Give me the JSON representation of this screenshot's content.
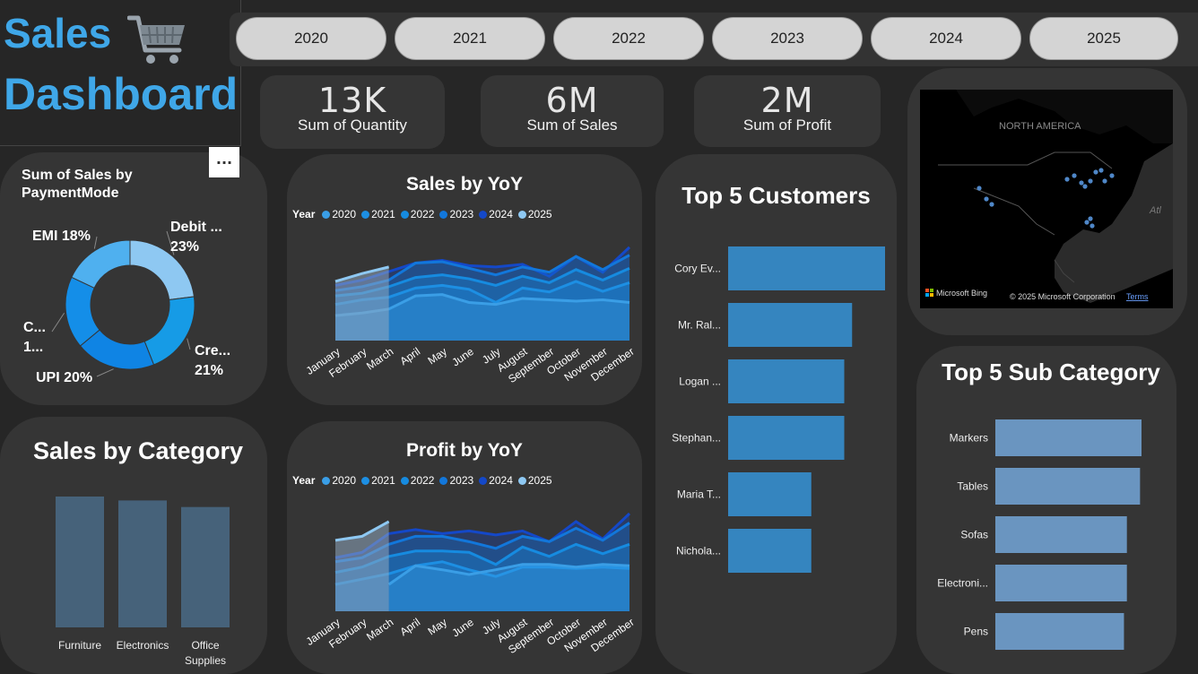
{
  "header": {
    "title_line1": "Sales",
    "title_line2": "Dashboard",
    "cart_icon": "shopping-cart-icon"
  },
  "year_slicer": [
    "2020",
    "2021",
    "2022",
    "2023",
    "2024",
    "2025"
  ],
  "kpis": [
    {
      "value": "13K",
      "label": "Sum of Quantity"
    },
    {
      "value": "6M",
      "label": "Sum of Sales"
    },
    {
      "value": "2M",
      "label": "Sum of Profit"
    }
  ],
  "menu": {
    "more_options": "..."
  },
  "legend_title": "Year",
  "colors": {
    "title": "#3fa7e8",
    "series": [
      "#3a9ee6",
      "#1d8fe3",
      "#168be0",
      "#1277db",
      "#1448c8",
      "#8ec8f2"
    ],
    "customer_bar": "#3585bf",
    "subcategory_bar": "#6a95c0",
    "category_bar": "#46627a"
  },
  "map": {
    "region_label": "NORTH AMERICA",
    "ocean_label": "Atl",
    "attribution_logo": "Microsoft Bing",
    "copyright": "© 2025 Microsoft Corporation",
    "terms": "Terms"
  },
  "chart_data": [
    {
      "type": "pie",
      "title": "Sum of Sales by PaymentMode",
      "categories": [
        "Debit ...",
        "Cre...",
        "UPI",
        "C...",
        "EMI"
      ],
      "values": [
        23,
        21,
        20,
        18,
        18
      ],
      "labels": [
        "Debit ...\n23%",
        "Cre...\n21%",
        "UPI 20%",
        "C...\n1...",
        "EMI 18%"
      ],
      "colors": [
        "#8ec8f2",
        "#169be6",
        "#0f84e4",
        "#148ee8",
        "#4fb0ef"
      ]
    },
    {
      "type": "area",
      "title": "Sales by YoY",
      "categories": [
        "January",
        "February",
        "March",
        "April",
        "May",
        "June",
        "July",
        "August",
        "September",
        "October",
        "November",
        "December"
      ],
      "series": [
        {
          "name": "2020",
          "values": [
            38,
            42,
            48,
            68,
            70,
            58,
            55,
            64,
            62,
            60,
            62,
            58
          ]
        },
        {
          "name": "2021",
          "values": [
            55,
            62,
            66,
            80,
            84,
            78,
            58,
            80,
            74,
            90,
            75,
            88
          ]
        },
        {
          "name": "2022",
          "values": [
            68,
            72,
            82,
            96,
            100,
            94,
            84,
            98,
            88,
            108,
            92,
            110
          ]
        },
        {
          "name": "2023",
          "values": [
            76,
            82,
            92,
            118,
            120,
            110,
            100,
            112,
            104,
            128,
            108,
            130
          ]
        },
        {
          "name": "2024",
          "values": [
            84,
            92,
            105,
            118,
            122,
            114,
            112,
            116,
            98,
            128,
            104,
            142
          ]
        },
        {
          "name": "2025",
          "values": [
            90,
            102,
            112,
            null,
            null,
            null,
            null,
            null,
            null,
            null,
            null,
            null
          ]
        }
      ]
    },
    {
      "type": "area",
      "title": "Profit by YoY",
      "categories": [
        "January",
        "February",
        "March",
        "April",
        "May",
        "June",
        "July",
        "August",
        "September",
        "October",
        "November",
        "December"
      ],
      "series": [
        {
          "name": "2020",
          "values": [
            null,
            null,
            40,
            68,
            62,
            55,
            62,
            70,
            70,
            66,
            70,
            68
          ]
        },
        {
          "name": "2021",
          "values": [
            40,
            48,
            56,
            68,
            74,
            62,
            52,
            66,
            66,
            64,
            66,
            64
          ]
        },
        {
          "name": "2022",
          "values": [
            58,
            66,
            82,
            90,
            90,
            88,
            70,
            96,
            82,
            100,
            86,
            100
          ]
        },
        {
          "name": "2023",
          "values": [
            74,
            80,
            100,
            112,
            112,
            104,
            94,
            112,
            104,
            124,
            106,
            132
          ]
        },
        {
          "name": "2024",
          "values": [
            80,
            88,
            116,
            122,
            116,
            120,
            114,
            120,
            104,
            134,
            108,
            146
          ]
        },
        {
          "name": "2025",
          "values": [
            106,
            112,
            134,
            null,
            null,
            null,
            null,
            null,
            null,
            null,
            null,
            null
          ]
        }
      ]
    },
    {
      "type": "bar",
      "title": "Sales by Category",
      "categories": [
        "Furniture",
        "Electronics",
        "Office Supplies"
      ],
      "values": [
        100,
        97,
        92
      ]
    },
    {
      "type": "bar",
      "title": "Top 5 Customers",
      "orientation": "horizontal",
      "categories": [
        "Cory Ev...",
        "Mr. Ral...",
        "Logan ...",
        "Stephan...",
        "Maria T...",
        "Nichola..."
      ],
      "values": [
        100,
        79,
        74,
        74,
        53,
        53
      ]
    },
    {
      "type": "bar",
      "title": "Top 5 Sub Category",
      "orientation": "horizontal",
      "categories": [
        "Markers",
        "Tables",
        "Sofas",
        "Electroni...",
        "Pens"
      ],
      "values": [
        100,
        99,
        90,
        90,
        88
      ]
    }
  ]
}
